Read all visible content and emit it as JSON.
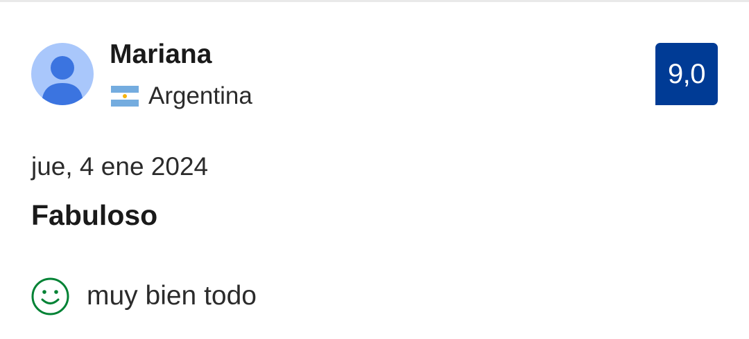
{
  "review": {
    "reviewer": {
      "name": "Mariana",
      "country": "Argentina",
      "flag_icon": "argentina-flag-icon",
      "avatar_icon": "user-avatar-icon"
    },
    "score": "9,0",
    "date": "jue, 4 ene 2024",
    "title": "Fabuloso",
    "positive": {
      "icon": "smile-icon",
      "text": "muy bien todo"
    }
  },
  "colors": {
    "score_badge_bg": "#003b95",
    "avatar_bg": "#a9c7fb",
    "avatar_figure": "#3b74e0",
    "positive_icon": "#008234",
    "flag_blue": "#74acdf",
    "flag_sun": "#f6b40e"
  }
}
